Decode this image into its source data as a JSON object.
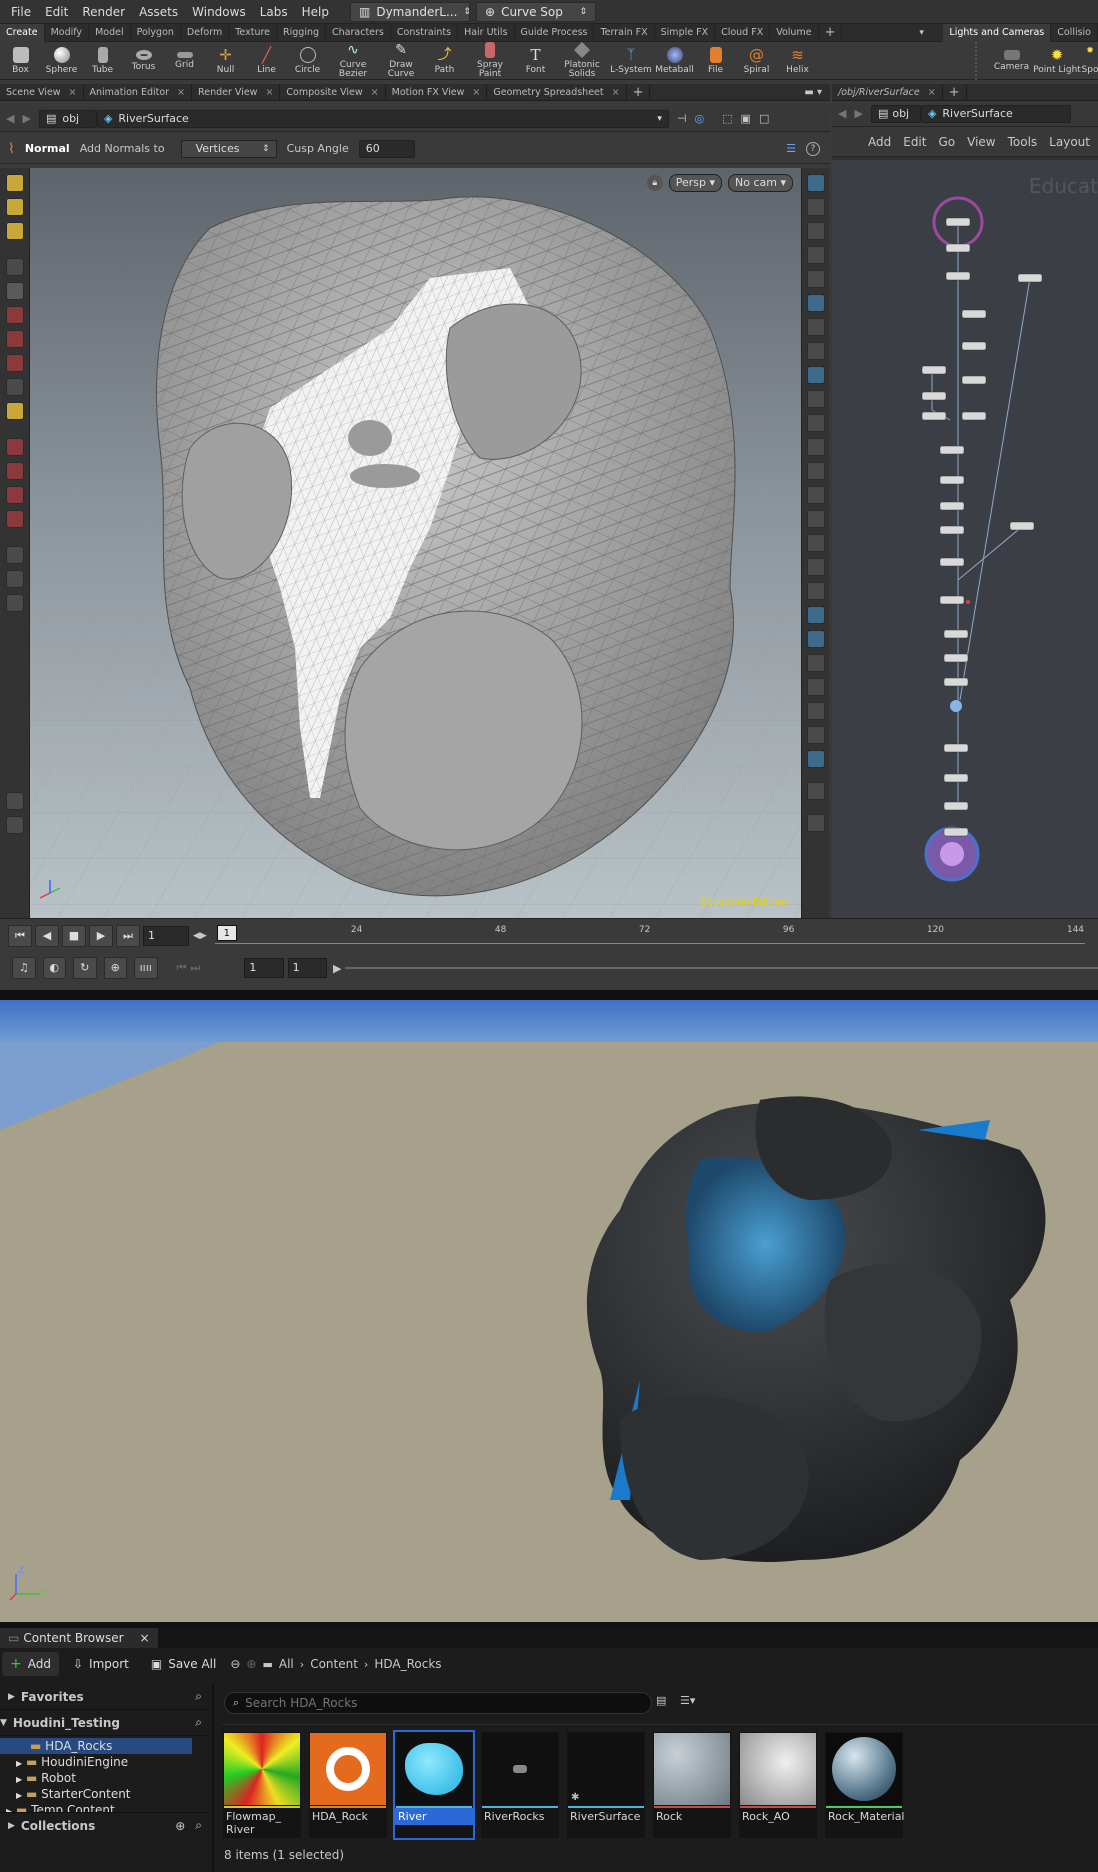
{
  "houdini": {
    "menu": [
      "File",
      "Edit",
      "Render",
      "Assets",
      "Windows",
      "Labs",
      "Help"
    ],
    "desktop_label": "DymanderL...",
    "sop_label": "Curve Sop",
    "shelf_tabs": [
      "Create",
      "Modify",
      "Model",
      "Polygon",
      "Deform",
      "Texture",
      "Rigging",
      "Characters",
      "Constraints",
      "Hair Utils",
      "Guide Process",
      "Terrain FX",
      "Simple FX",
      "Cloud FX",
      "Volume"
    ],
    "shelf_tabs_right": [
      "Lights and Cameras",
      "Collisio"
    ],
    "shelf_tools": [
      "Box",
      "Sphere",
      "Tube",
      "Torus",
      "Grid",
      "Null",
      "Line",
      "Circle",
      "Curve Bezier",
      "Draw Curve",
      "Path",
      "Spray Paint",
      "Font",
      "Platonic Solids",
      "L-System",
      "Metaball",
      "File",
      "Spiral",
      "Helix"
    ],
    "shelf_tools_right": [
      "Camera",
      "Point Light",
      "Spo"
    ],
    "pane_tabs": [
      "Scene View",
      "Animation Editor",
      "Render View",
      "Composite View",
      "Motion FX View",
      "Geometry Spreadsheet"
    ],
    "net_tab": "/obj/RiverSurface",
    "path_obj": "obj",
    "path_node": "RiverSurface",
    "op": {
      "name": "Normal",
      "add_normals_label": "Add Normals to",
      "add_normals_value": "Vertices",
      "cusp_label": "Cusp Angle",
      "cusp_value": "60"
    },
    "viewport": {
      "persp": "Persp",
      "cam": "No cam",
      "watermark": "Education Edition"
    },
    "net_menu": [
      "Add",
      "Edit",
      "Go",
      "View",
      "Tools",
      "Layout"
    ],
    "net_watermark": "Educat",
    "timeline": {
      "frame": "1",
      "marker": "1",
      "ticks": [
        "24",
        "48",
        "72",
        "96",
        "120",
        "144"
      ],
      "start": "1",
      "end": "1"
    }
  },
  "unreal": {
    "cb_tab": "Content Browser",
    "add": "Add",
    "import": "Import",
    "save_all": "Save All",
    "breadcrumbs": [
      "All",
      "Content",
      "HDA_Rocks"
    ],
    "favorites": "Favorites",
    "project": "Houdini_Testing",
    "folders": [
      "HDA_Rocks",
      "HoudiniEngine",
      "Robot",
      "StarterContent",
      "Temp Content"
    ],
    "collections": "Collections",
    "search_placeholder": "Search HDA_Rocks",
    "assets": [
      {
        "line1": "Flowmap_",
        "line2": "River",
        "bar": "#c9c94a"
      },
      {
        "line1": "HDA_Rock",
        "line2": "",
        "bar": "#c98a3a"
      },
      {
        "line1": "River",
        "line2": "",
        "bar": "#4fb5d8"
      },
      {
        "line1": "RiverRocks",
        "line2": "",
        "bar": "#4fb5d8"
      },
      {
        "line1": "RiverSurface",
        "line2": "",
        "bar": "#4fb5d8"
      },
      {
        "line1": "Rock",
        "line2": "",
        "bar": "#c94a4a"
      },
      {
        "line1": "Rock_AO",
        "line2": "",
        "bar": "#c94a4a"
      },
      {
        "line1": "Rock_Material",
        "line2": "",
        "bar": "#4ac96a"
      }
    ],
    "status": "8 items (1 selected)",
    "axis": {
      "z": "Z",
      "y": "Y"
    }
  }
}
